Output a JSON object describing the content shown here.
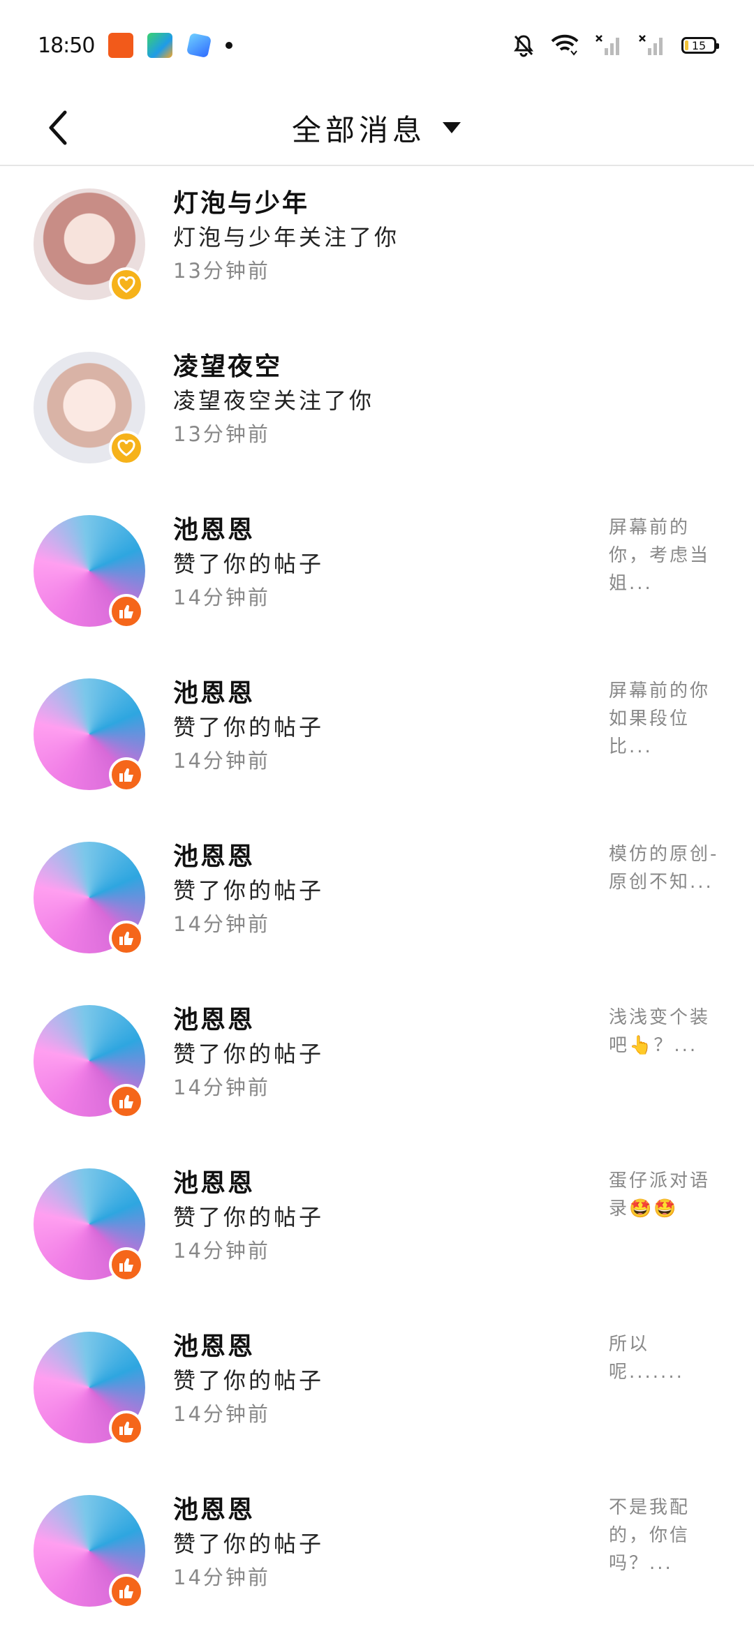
{
  "status_bar": {
    "time": "18:50",
    "battery": "15"
  },
  "header": {
    "title": "全部消息"
  },
  "messages": [
    {
      "name": "灯泡与少年",
      "action": "灯泡与少年关注了你",
      "time": "13分钟前",
      "preview": "",
      "type": "follow"
    },
    {
      "name": "凌望夜空",
      "action": "凌望夜空关注了你",
      "time": "13分钟前",
      "preview": "",
      "type": "follow"
    },
    {
      "name": "池恩恩",
      "action": "赞了你的帖子",
      "time": "14分钟前",
      "preview": "屏幕前的你，考虑当姐...",
      "type": "like"
    },
    {
      "name": "池恩恩",
      "action": "赞了你的帖子",
      "time": "14分钟前",
      "preview": "屏幕前的你如果段位比...",
      "type": "like"
    },
    {
      "name": "池恩恩",
      "action": "赞了你的帖子",
      "time": "14分钟前",
      "preview": "模仿的原创-原创不知...",
      "type": "like"
    },
    {
      "name": "池恩恩",
      "action": "赞了你的帖子",
      "time": "14分钟前",
      "preview": " 浅浅变个装吧👆？...",
      "type": "like"
    },
    {
      "name": "池恩恩",
      "action": "赞了你的帖子",
      "time": "14分钟前",
      "preview": "蛋仔派对语录🤩🤩",
      "type": "like"
    },
    {
      "name": "池恩恩",
      "action": "赞了你的帖子",
      "time": "14分钟前",
      "preview": "所以呢.......",
      "type": "like"
    },
    {
      "name": "池恩恩",
      "action": "赞了你的帖子",
      "time": "14分钟前",
      "preview": "不是我配的，你信吗？...",
      "type": "like"
    }
  ],
  "colors": {
    "follow_badge": "#f6b21a",
    "like_badge": "#f5661a",
    "divider": "#e5e5e5"
  }
}
